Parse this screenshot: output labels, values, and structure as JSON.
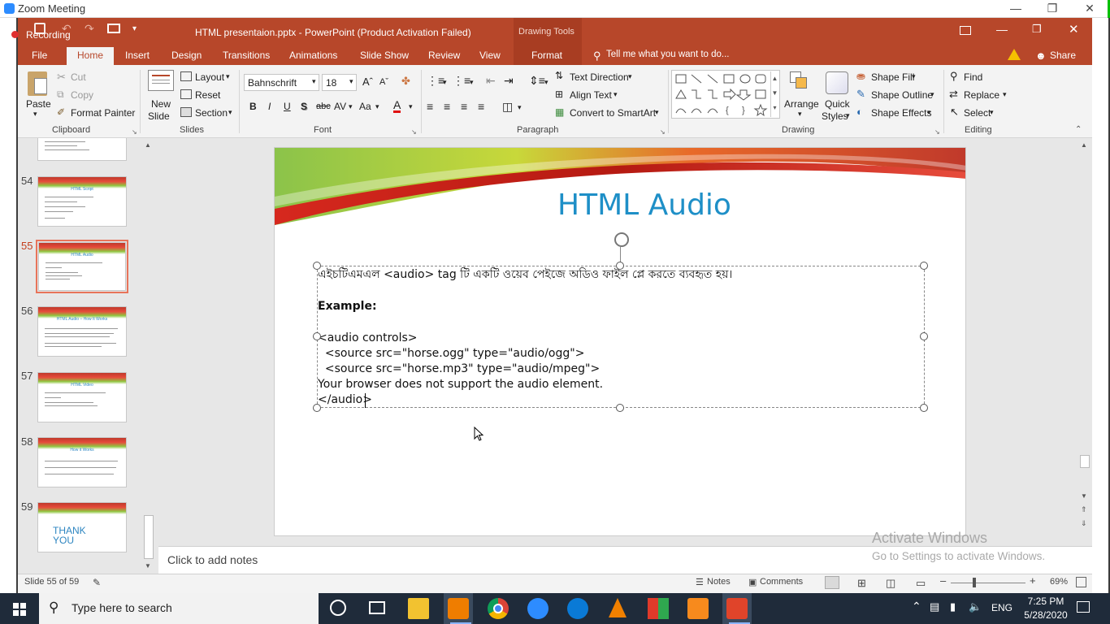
{
  "zoom": {
    "title": "Zoom Meeting",
    "recording": "Recording"
  },
  "app": {
    "doc_title": "HTML presentaion.pptx - PowerPoint (Product Activation Failed)",
    "context_group": "Drawing Tools",
    "tell_me": "Tell me what you want to do...",
    "share": "Share"
  },
  "tabs": [
    "File",
    "Home",
    "Insert",
    "Design",
    "Transitions",
    "Animations",
    "Slide Show",
    "Review",
    "View",
    "Format"
  ],
  "ribbon": {
    "clipboard": {
      "paste": "Paste",
      "cut": "Cut",
      "copy": "Copy",
      "format_painter": "Format Painter",
      "group": "Clipboard"
    },
    "slides": {
      "new_slide_1": "New",
      "new_slide_2": "Slide",
      "layout": "Layout",
      "reset": "Reset",
      "section": "Section",
      "group": "Slides"
    },
    "font": {
      "name": "Bahnschrift",
      "size": "18",
      "bold": "B",
      "italic": "I",
      "underline": "U",
      "shadow": "S",
      "strike": "abc",
      "spacing": "AV",
      "case": "Aa",
      "color": "A",
      "group": "Font"
    },
    "paragraph": {
      "text_direction": "Text Direction",
      "align_text": "Align Text",
      "smartart": "Convert to SmartArt",
      "group": "Paragraph"
    },
    "drawing": {
      "arrange": "Arrange",
      "quick_1": "Quick",
      "quick_2": "Styles",
      "fill": "Shape Fill",
      "outline": "Shape Outline",
      "effects": "Shape Effects",
      "group": "Drawing"
    },
    "editing": {
      "find": "Find",
      "replace": "Replace",
      "select": "Select",
      "group": "Editing"
    }
  },
  "thumbnails": [
    {
      "num": "54",
      "title": "HTML Script"
    },
    {
      "num": "55",
      "title": "HTML Audio"
    },
    {
      "num": "56",
      "title": "HTML Audio – How It Works"
    },
    {
      "num": "57",
      "title": "HTML Video"
    },
    {
      "num": "58",
      "title": "How it Works"
    },
    {
      "num": "59",
      "title": "THANK YOU"
    }
  ],
  "slide": {
    "title": "HTML Audio",
    "lines": [
      "এইচটিএমএল <audio> tag টি একটি ওয়েব পেইজে অডিও ফাইল প্লে করতে ব্যবহৃত হয়।",
      "",
      "Example:",
      "",
      "<audio controls>",
      "  <source src=\"horse.ogg\" type=\"audio/ogg\">",
      "  <source src=\"horse.mp3\" type=\"audio/mpeg\">",
      "Your browser does not support the audio element.",
      "</audio>"
    ]
  },
  "notes_placeholder": "Click to add notes",
  "watermark": {
    "line1": "Activate Windows",
    "line2": "Go to Settings to activate Windows."
  },
  "status": {
    "slide": "Slide 55 of 59",
    "notes": "Notes",
    "comments": "Comments",
    "zoom": "69%"
  },
  "taskbar": {
    "search": "Type here to search",
    "lang": "ENG",
    "time": "7:25 PM",
    "date": "5/28/2020"
  },
  "colors": {
    "ppt_accent": "#b7472a",
    "title_blue": "#1e8fc7",
    "taskbar": "#1f2b3a"
  }
}
